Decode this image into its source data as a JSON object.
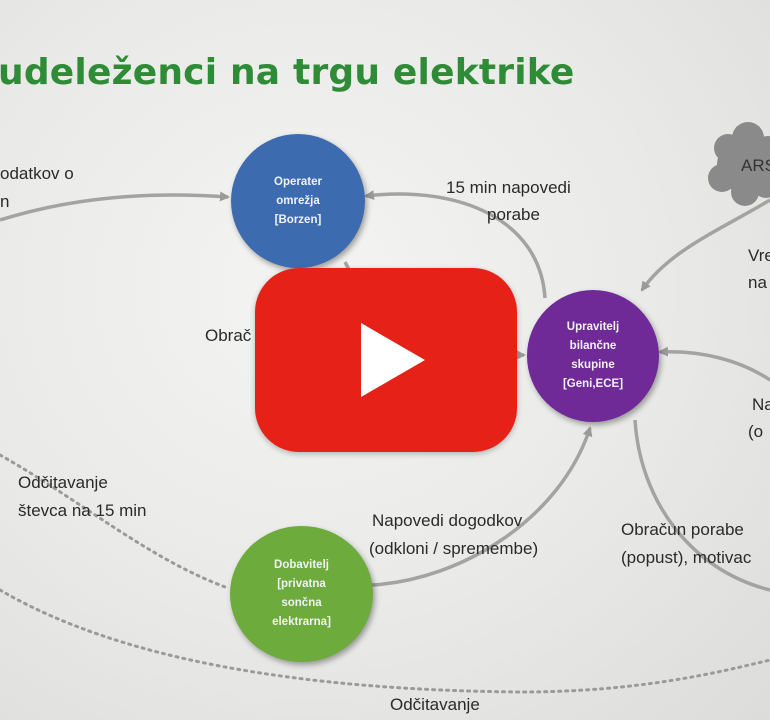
{
  "slide": {
    "title": "udeleženci na trgu elektrike",
    "nodes": {
      "operater": {
        "text": "Operater\nomrežja\n[Borzen]",
        "color": "#3d6bb0"
      },
      "upravitelj": {
        "text": "Upravitelj\nbilančne\nskupine\n[Geni,ECE]",
        "color": "#6f2a97"
      },
      "dobavitelj": {
        "text": "Dobavitelj\n[privatna\nsončna\nelektrarna]",
        "color": "#6cab3c"
      }
    },
    "cloud_label": "ARS",
    "labels": {
      "top_left_1": "odatkov o",
      "top_left_2": "n",
      "forecast_1": "15 min napovedi",
      "forecast_2": "porabe",
      "obracun_left": "Obrač",
      "vre_1": "Vre",
      "vre_2": "na",
      "na_1": "Na",
      "na_2": "(o",
      "odcitavanje_1": "Odčitavanje",
      "odcitavanje_2": "števca na 15 min",
      "napovedi_1": "Napovedi dogodkov",
      "napovedi_2": "(odkloni / spremembe)",
      "obracun_1": "Obračun porabe",
      "obracun_2": "(popust), motivac",
      "odcitavanje_bottom": "Odčitavanje"
    }
  },
  "player": {
    "play_button": "youtube-play"
  },
  "colors": {
    "title": "#2e8b36",
    "arrow": "#9a9a9a",
    "play_red": "#e62117"
  }
}
